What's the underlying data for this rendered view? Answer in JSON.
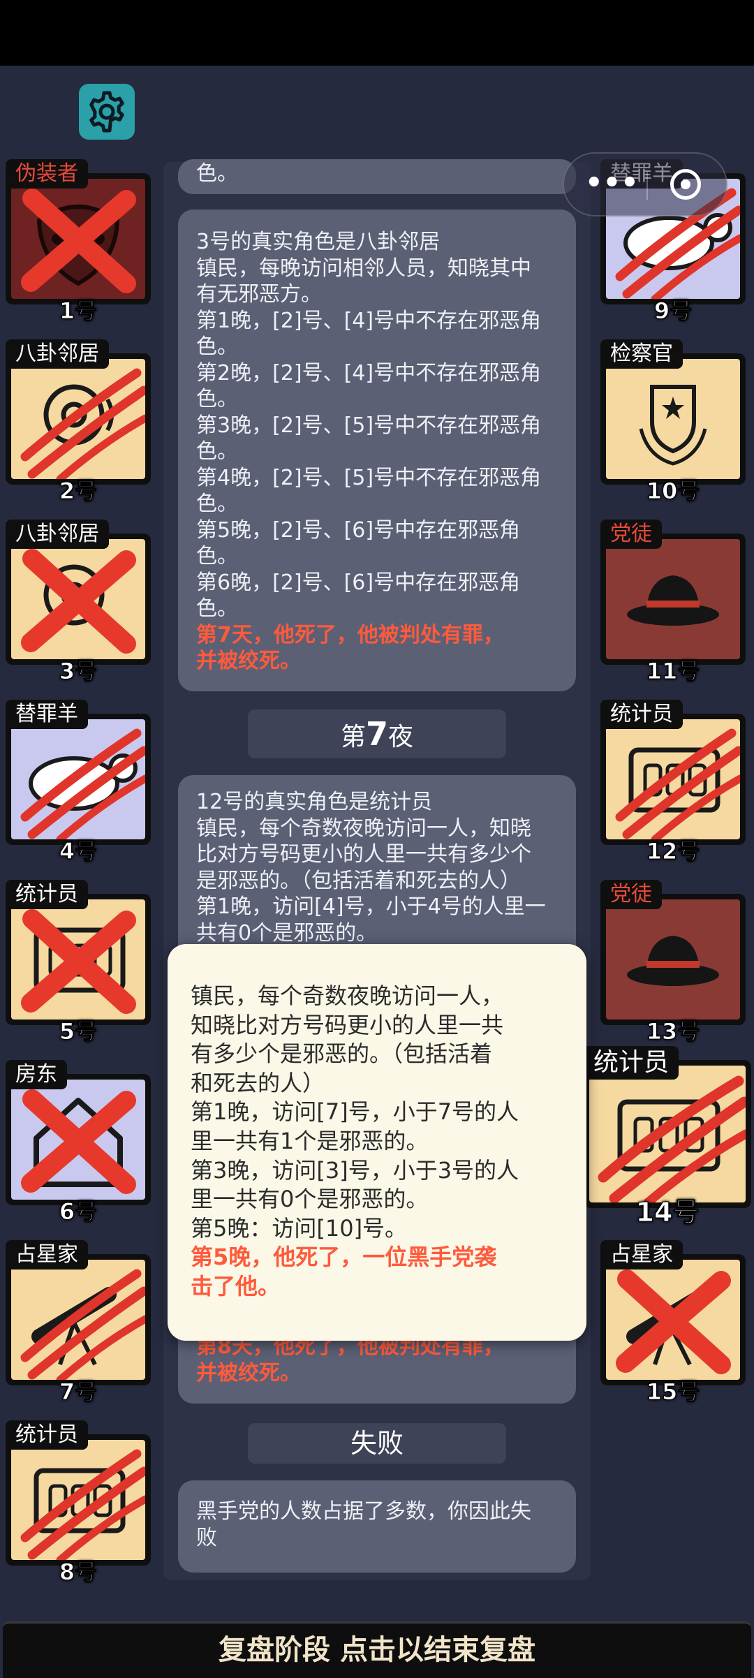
{
  "colors": {
    "accent_evil": "#e84a3a",
    "panel": "#2e3247",
    "box": "#5b6075",
    "popup": "#fbf8e8"
  },
  "players": [
    {
      "id": 1,
      "label": "1号",
      "role": "伪装者",
      "evil": true,
      "bg": "evil",
      "dead_mark": "cross",
      "icon": "mask-icon"
    },
    {
      "id": 2,
      "label": "2号",
      "role": "八卦邻居",
      "evil": false,
      "bg": "town",
      "dead_mark": "claw",
      "icon": "gossip-icon"
    },
    {
      "id": 3,
      "label": "3号",
      "role": "八卦邻居",
      "evil": false,
      "bg": "town",
      "dead_mark": "cross",
      "icon": "gossip-icon"
    },
    {
      "id": 4,
      "label": "4号",
      "role": "替罪羊",
      "evil": false,
      "bg": "out",
      "dead_mark": "claw",
      "icon": "sheep-icon"
    },
    {
      "id": 5,
      "label": "5号",
      "role": "统计员",
      "evil": false,
      "bg": "town",
      "dead_mark": "cross",
      "icon": "abacus-icon"
    },
    {
      "id": 6,
      "label": "6号",
      "role": "房东",
      "evil": false,
      "bg": "out",
      "dead_mark": "cross",
      "icon": "house-icon"
    },
    {
      "id": 7,
      "label": "7号",
      "role": "占星家",
      "evil": false,
      "bg": "town",
      "dead_mark": "claw",
      "icon": "telescope-icon"
    },
    {
      "id": 8,
      "label": "8号",
      "role": "统计员",
      "evil": false,
      "bg": "town",
      "dead_mark": "claw",
      "icon": "abacus-icon"
    },
    {
      "id": 9,
      "label": "9号",
      "role": "替罪羊",
      "evil": false,
      "bg": "out",
      "dead_mark": "claw",
      "icon": "sheep-icon"
    },
    {
      "id": 10,
      "label": "10号",
      "role": "检察官",
      "evil": false,
      "bg": "town",
      "dead_mark": "none",
      "icon": "badge-icon"
    },
    {
      "id": 11,
      "label": "11号",
      "role": "党徒",
      "evil": true,
      "bg": "min",
      "dead_mark": "none",
      "icon": "hat-icon"
    },
    {
      "id": 12,
      "label": "12号",
      "role": "统计员",
      "evil": false,
      "bg": "town",
      "dead_mark": "claw",
      "icon": "abacus-icon"
    },
    {
      "id": 13,
      "label": "13号",
      "role": "党徒",
      "evil": true,
      "bg": "min",
      "dead_mark": "none",
      "icon": "hat-icon"
    },
    {
      "id": 14,
      "label": "14号",
      "role": "统计员",
      "evil": false,
      "bg": "town",
      "dead_mark": "claw",
      "icon": "abacus-icon"
    },
    {
      "id": 15,
      "label": "15号",
      "role": "占星家",
      "evil": false,
      "bg": "town",
      "dead_mark": "cross",
      "icon": "telescope-icon"
    }
  ],
  "log": {
    "top_fragment": "色。",
    "entry3": {
      "lines": [
        "3号的真实角色是八卦邻居",
        "镇民，每晚访问相邻人员，知晓其中",
        "有无邪恶方。",
        "第1晚，[2]号、[4]号中不存在邪恶角",
        "色。",
        "第2晚，[2]号、[4]号中不存在邪恶角",
        "色。",
        "第3晚，[2]号、[5]号中不存在邪恶角",
        "色。",
        "第4晚，[2]号、[5]号中不存在邪恶角",
        "色。",
        "第5晚，[2]号、[6]号中存在邪恶角",
        "色。",
        "第6晚，[2]号、[6]号中存在邪恶角",
        "色。"
      ],
      "death": [
        "第7天，他死了，他被判处有罪，",
        "并被绞死。"
      ]
    },
    "night7_prefix": "第",
    "night7_number": "7",
    "night7_suffix": "夜",
    "entry12": {
      "lines": [
        "12号的真实角色是统计员",
        "镇民，每个奇数夜晚访问一人，知晓",
        "比对方号码更小的人里一共有多少个",
        "是邪恶的。（包括活着和死去的人）",
        "第1晚，访问[4]号，小于4号的人里一",
        "共有0个是邪恶的。"
      ],
      "death": [
        "第8天，他死了，他被判处有罪，",
        "并被绞死。"
      ]
    },
    "result_header": "失败",
    "result_lines": [
      "黑手党的人数占据了多数，你因此失",
      "败"
    ]
  },
  "popup": {
    "lines": [
      "镇民，每个奇数夜晚访问一人，",
      "知晓比对方号码更小的人里一共",
      "有多少个是邪恶的。（包括活着",
      "和死去的人）",
      "第1晚，访问[7]号，小于7号的人",
      "里一共有1个是邪恶的。",
      "第3晚，访问[3]号，小于3号的人",
      "里一共有0个是邪恶的。",
      "第5晚：访问[10]号。"
    ],
    "death": [
      "第5晚，他死了，一位黑手党袭",
      "击了他。"
    ]
  },
  "bottom_bar": "复盘阶段 点击以结束复盘"
}
